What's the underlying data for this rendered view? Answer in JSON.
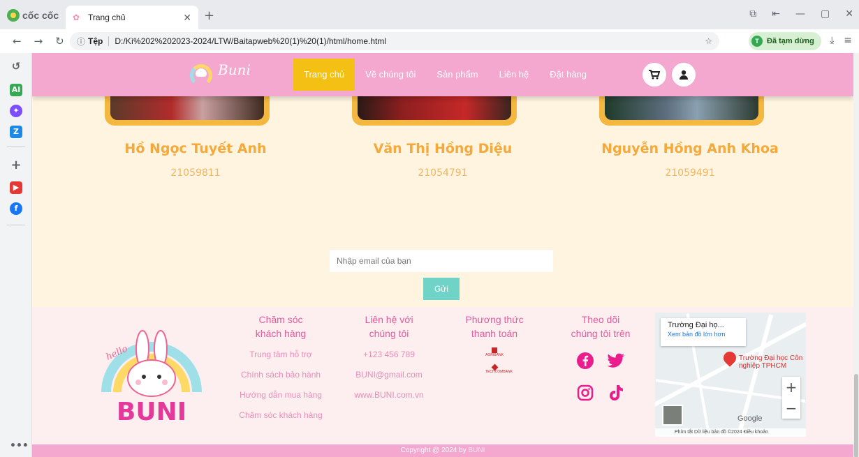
{
  "browser": {
    "brand": "cốc cốc",
    "tab_title": "Trang chủ",
    "address_scheme": "Tệp",
    "address_url": "D:/Kì%202%202023-2024/LTW/Baitapweb%20(1)%20(1)/html/home.html",
    "profile_initial": "T",
    "profile_status": "Đã tạm dừng",
    "sidebar_ai_label": "AI"
  },
  "site": {
    "logo_text": "Buni",
    "menu": [
      "Trang chủ",
      "Về chúng tôi",
      "Sản phẩm",
      "Liên hệ",
      "Đặt hàng"
    ],
    "active_menu": "Trang chủ",
    "members": [
      {
        "name": "Hồ Ngọc Tuyết Anh",
        "id": "21059811"
      },
      {
        "name": "Văn Thị Hồng Diệu",
        "id": "21054791"
      },
      {
        "name": "Nguyễn Hồng Anh Khoa",
        "id": "21059491"
      }
    ],
    "subscribe": {
      "placeholder": "Nhập email của bạn",
      "button": "Gửi"
    },
    "footer": {
      "logo_script": "hello",
      "logo_word": "BUNI",
      "care": {
        "title_1": "Chăm sóc",
        "title_2": "khách hàng",
        "items": [
          "Trung tâm hỗ trợ",
          "Chính sách bảo hành",
          "Hướng dẫn mua hàng",
          "Chăm sóc khách hàng"
        ]
      },
      "contact": {
        "title_1": "Liên hệ với",
        "title_2": "chúng tôi",
        "items": [
          "+123 456 789",
          "BUNI@gmail.com",
          "www.BUNI.com.vn"
        ]
      },
      "payment": {
        "title_1": "Phương thức",
        "title_2": "thanh toán",
        "banks": [
          "AGRIBANK",
          "TECHCOMBANK"
        ]
      },
      "follow": {
        "title_1": "Theo dõi",
        "title_2": "chúng tôi trên"
      },
      "map": {
        "card_title": "Trường Đại họ...",
        "card_link": "Xem bản đồ lớn hơn",
        "pin_label_1": "Trường Đại học Côn",
        "pin_label_2": "nghiệp TPHCM",
        "google": "Google",
        "attribution": "Phím tắt   Dữ liệu bản đồ ©2024   Điều khoản"
      }
    },
    "copyright_prefix": "Copyright @ 2024 by ",
    "copyright_brand": "BUNI"
  }
}
